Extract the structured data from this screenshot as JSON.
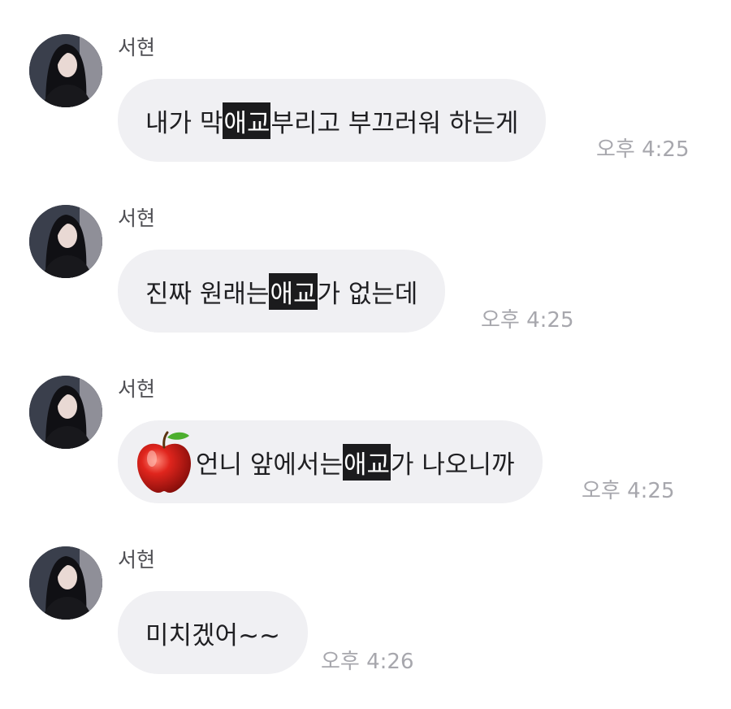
{
  "messages": [
    {
      "sender": "서현",
      "segments": [
        "내가 막 ",
        "애교",
        " 부리고 부끄러워 하는게"
      ],
      "time": "오후 4:25"
    },
    {
      "sender": "서현",
      "segments": [
        "진짜 원래는 ",
        "애교",
        "가 없는데"
      ],
      "time": "오후 4:25"
    },
    {
      "sender": "서현",
      "emoji": "apple-emoji",
      "segments": [
        "언니 앞에서는 ",
        "애교",
        "가 나오니까"
      ],
      "time": "오후 4:25"
    },
    {
      "sender": "서현",
      "segments": [
        "미치겠어~~"
      ],
      "time": "오후 4:26"
    }
  ],
  "colors": {
    "bubble": "#f0f0f3",
    "highlight": "#1b1b1d",
    "time": "#a7a7ad"
  }
}
